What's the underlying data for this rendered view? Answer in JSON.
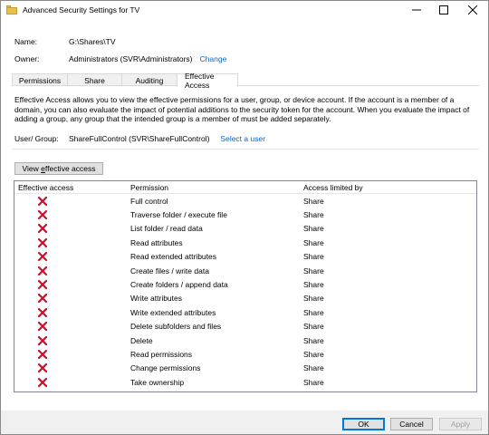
{
  "window": {
    "title": "Advanced Security Settings for TV",
    "minimize_icon": "minimize-icon",
    "maximize_icon": "maximize-icon",
    "close_icon": "close-icon"
  },
  "header": {
    "name_label": "Name:",
    "name_value": "G:\\Shares\\TV",
    "owner_label": "Owner:",
    "owner_value": "Administrators (SVR\\Administrators)",
    "owner_change": "Change"
  },
  "tabs": [
    {
      "label": "Permissions",
      "active": false
    },
    {
      "label": "Share",
      "active": false
    },
    {
      "label": "Auditing",
      "active": false
    },
    {
      "label": "Effective Access",
      "active": true
    }
  ],
  "effective_access": {
    "description": "Effective Access allows you to view the effective permissions for a user, group, or device account. If the account is a member of a domain, you can also evaluate the impact of potential additions to the security token for the account. When you evaluate the impact of adding a group, any group that the intended group is a member of must be added separately.",
    "user_label": "User/ Group:",
    "user_value": "ShareFullControl (SVR\\ShareFullControl)",
    "select_user": "Select a user",
    "view_button_prefix": "View ",
    "view_button_underlined": "e",
    "view_button_suffix": "ffective access"
  },
  "list": {
    "columns": [
      "Effective access",
      "Permission",
      "Access limited by"
    ],
    "rows": [
      {
        "access": "deny-x-icon",
        "permission": "Full control",
        "limited_by": "Share"
      },
      {
        "access": "deny-x-icon",
        "permission": "Traverse folder / execute file",
        "limited_by": "Share"
      },
      {
        "access": "deny-x-icon",
        "permission": "List folder / read data",
        "limited_by": "Share"
      },
      {
        "access": "deny-x-icon",
        "permission": "Read attributes",
        "limited_by": "Share"
      },
      {
        "access": "deny-x-icon",
        "permission": "Read extended attributes",
        "limited_by": "Share"
      },
      {
        "access": "deny-x-icon",
        "permission": "Create files / write data",
        "limited_by": "Share"
      },
      {
        "access": "deny-x-icon",
        "permission": "Create folders / append data",
        "limited_by": "Share"
      },
      {
        "access": "deny-x-icon",
        "permission": "Write attributes",
        "limited_by": "Share"
      },
      {
        "access": "deny-x-icon",
        "permission": "Write extended attributes",
        "limited_by": "Share"
      },
      {
        "access": "deny-x-icon",
        "permission": "Delete subfolders and files",
        "limited_by": "Share"
      },
      {
        "access": "deny-x-icon",
        "permission": "Delete",
        "limited_by": "Share"
      },
      {
        "access": "deny-x-icon",
        "permission": "Read permissions",
        "limited_by": "Share"
      },
      {
        "access": "deny-x-icon",
        "permission": "Change permissions",
        "limited_by": "Share"
      },
      {
        "access": "deny-x-icon",
        "permission": "Take ownership",
        "limited_by": "Share"
      }
    ]
  },
  "footer": {
    "ok": "OK",
    "cancel": "Cancel",
    "apply": "Apply"
  },
  "colors": {
    "link": "#0066cc",
    "deny_red": "#c8102e",
    "default_button_border": "#0078d7"
  }
}
